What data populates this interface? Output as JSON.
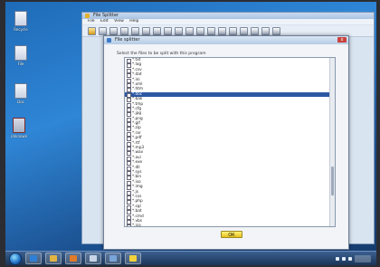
{
  "app": {
    "title": "File Splitter",
    "menu": [
      "File",
      "Edit",
      "View",
      "Help"
    ]
  },
  "dialog": {
    "title": "File splitter",
    "close_label": "x",
    "instruction": "Select the files to be split with this program",
    "ok_label": "OK",
    "selected_index": 7,
    "items": [
      "*.txt",
      "*.log",
      "*.csv",
      "*.dat",
      "*.ini",
      "*.xml",
      "*.htm",
      "*.doc",
      "*.bak",
      "*.tmp",
      "*.cfg",
      "*.jpg",
      "*.png",
      "*.gif",
      "*.zip",
      "*.rar",
      "*.pdf",
      "*.rtf",
      "*.mp3",
      "*.wav",
      "*.avi",
      "*.exe",
      "*.dll",
      "*.sys",
      "*.bin",
      "*.iso",
      "*.img",
      "*.js",
      "*.css",
      "*.php",
      "*.sql",
      "*.bat",
      "*.cmd",
      "*.vbs",
      "*.ico",
      "*.py"
    ]
  },
  "desktop": {
    "icons": [
      "Recycle",
      "File",
      "Doc",
      "Unknown"
    ]
  },
  "taskbar": {
    "items": [
      "ie",
      "folder",
      "media",
      "app",
      "app2",
      "splitter"
    ]
  }
}
